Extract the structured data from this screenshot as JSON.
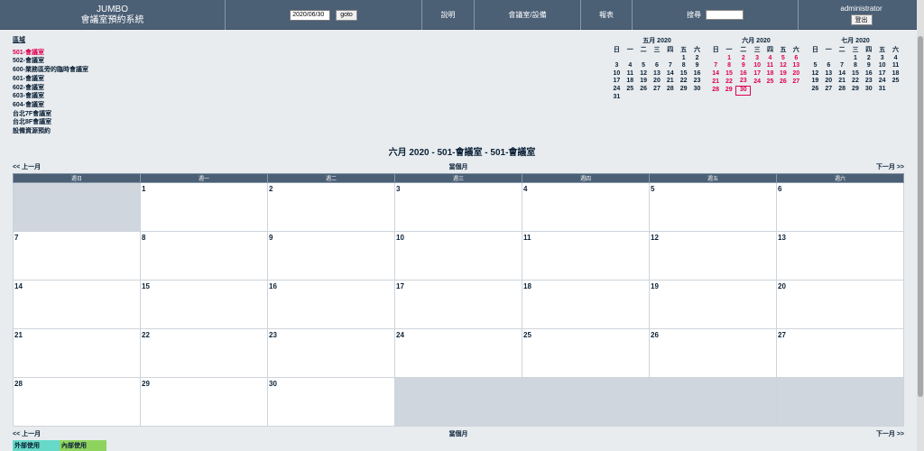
{
  "header": {
    "brand": "JUMBO",
    "system_name": "會議室預約系統",
    "goto_date": "2020/06/30",
    "goto_label": "goto",
    "help": "說明",
    "rooms": "會議室/設備",
    "reports": "報表",
    "search_label": "搜尋",
    "search_value": "",
    "user": "administrator",
    "logout": "登出"
  },
  "area": {
    "label": "區域",
    "rooms": [
      {
        "name": "501-會議室",
        "selected": true
      },
      {
        "name": "502-會議室",
        "selected": false
      },
      {
        "name": "600-業務區旁的臨時會議室",
        "selected": false
      },
      {
        "name": "601-會議室",
        "selected": false
      },
      {
        "name": "602-會議室",
        "selected": false
      },
      {
        "name": "603-會議室",
        "selected": false
      },
      {
        "name": "604-會議室",
        "selected": false
      },
      {
        "name": "台北7F會議室",
        "selected": false
      },
      {
        "name": "台北8F會議室",
        "selected": false
      },
      {
        "name": "設備資源預約",
        "selected": false
      }
    ]
  },
  "weekday_short": [
    "日",
    "一",
    "二",
    "三",
    "四",
    "五",
    "六"
  ],
  "mini_calendars": [
    {
      "title": "五月 2020",
      "offset": 5,
      "days": 31,
      "highlight": false,
      "today": null
    },
    {
      "title": "六月 2020",
      "offset": 1,
      "days": 30,
      "highlight": true,
      "today": 30
    },
    {
      "title": "七月 2020",
      "offset": 3,
      "days": 31,
      "highlight": false,
      "today": null
    }
  ],
  "main": {
    "title": "六月 2020 - 501-會議室 - 501-會議室",
    "prev": "<< 上一月",
    "current": "當個月",
    "next": "下一月 >>",
    "weekdays": [
      "週日",
      "週一",
      "週二",
      "週三",
      "週四",
      "週五",
      "週六"
    ],
    "offset": 1,
    "days": 30
  },
  "legend": [
    {
      "label": "外部使用",
      "color": "#66d9c8"
    },
    {
      "label": "內部使用",
      "color": "#8fd35f"
    }
  ]
}
